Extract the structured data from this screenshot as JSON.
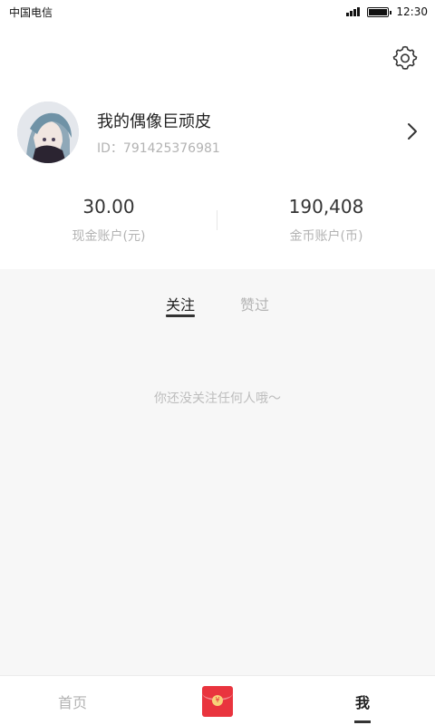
{
  "status_bar": {
    "carrier": "中国电信",
    "time": "12:30",
    "battery_level_percent": 100
  },
  "profile": {
    "name": "我的偶像巨顽皮",
    "id_text": "ID：791425376981",
    "avatar_icon": "anime-avatar"
  },
  "stats": {
    "cash": {
      "value": "30.00",
      "label": "现金账户(元)"
    },
    "coins": {
      "value": "190,408",
      "label": "金币账户(币)"
    }
  },
  "tabs": [
    {
      "label": "关注",
      "active": true
    },
    {
      "label": "赞过",
      "active": false
    }
  ],
  "empty_state": "你还没关注任何人哦～",
  "bottom_nav": {
    "home_label": "首页",
    "redpacket_icon": "red-envelope-icon",
    "redpacket_symbol": "¥",
    "me_label": "我"
  },
  "colors": {
    "accent": "#e9343e",
    "text_primary": "#222222",
    "text_secondary": "#b3b3b3",
    "section_bg": "#f7f7f7"
  }
}
